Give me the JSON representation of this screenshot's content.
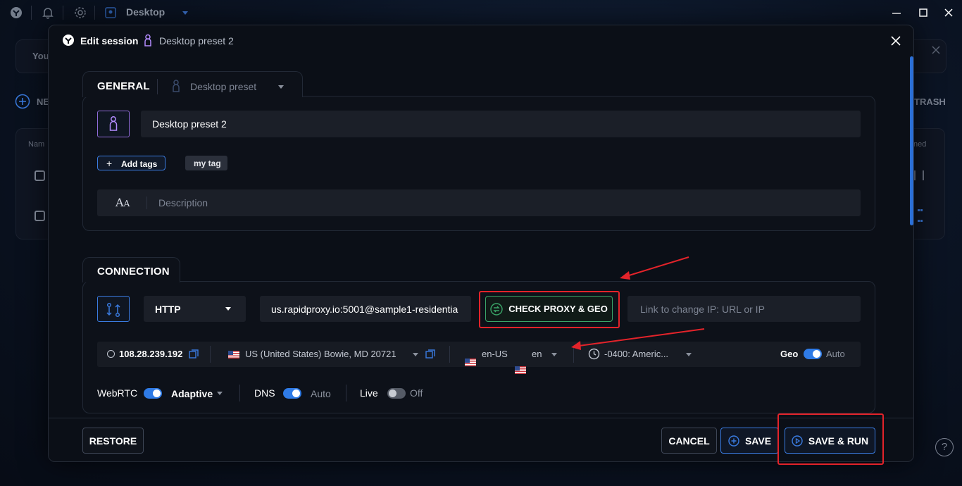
{
  "topbar": {
    "workspace": "Desktop"
  },
  "background": {
    "you_text": "You",
    "new_text": "NE",
    "trash_text": "TRASH",
    "name_col": "Nam",
    "ned_col": "ned"
  },
  "modal": {
    "title": "Edit session",
    "profile_name": "Desktop preset 2"
  },
  "general": {
    "tab_title": "GENERAL",
    "preset_select": "Desktop preset",
    "name_value": "Desktop preset 2",
    "add_tags_label": "Add tags",
    "tags": [
      "my tag"
    ],
    "description_placeholder": "Description"
  },
  "connection": {
    "tab_title": "CONNECTION",
    "protocol": "HTTP",
    "proxy_value": "us.rapidproxy.io:5001@sample1-residentia",
    "check_label": "CHECK PROXY & GEO",
    "change_ip_placeholder": "Link to change IP: URL or IP",
    "ip": "108.28.239.192",
    "location": "US (United States) Bowie, MD 20721",
    "language": "en-US",
    "language2": "en",
    "timezone": "-0400: Americ...",
    "geo_label": "Geo",
    "geo_mode": "Auto",
    "webrtc_label": "WebRTC",
    "webrtc_mode": "Adaptive",
    "dns_label": "DNS",
    "dns_mode": "Auto",
    "live_label": "Live",
    "live_mode": "Off"
  },
  "footer": {
    "restore": "RESTORE",
    "cancel": "CANCEL",
    "save": "SAVE",
    "save_run": "SAVE & RUN"
  },
  "colors": {
    "accent": "#3a7be0",
    "highlight": "#e3232a",
    "check_green": "#3aa568",
    "purple": "#b48cff"
  }
}
